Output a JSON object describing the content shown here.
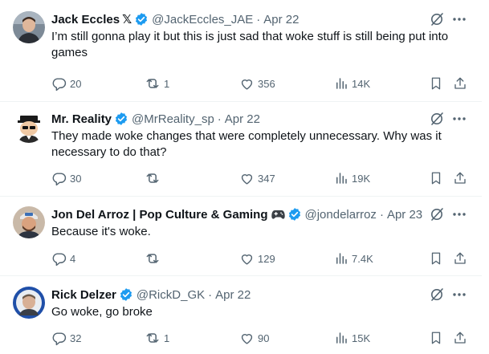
{
  "tweets": [
    {
      "name": "Jack Eccles",
      "name_suffix": "𝕏",
      "handle": "@JackEccles_JAE",
      "date": "Apr 22",
      "text": "I’m still gonna play it but this is just sad that woke stuff is still being put into games",
      "replies": "20",
      "reposts": "1",
      "likes": "356",
      "views": "14K"
    },
    {
      "name": "Mr. Reality",
      "name_suffix": "",
      "handle": "@MrReality_sp",
      "date": "Apr 22",
      "text": "They made woke changes that were completely unnecessary. Why was it necessary to do that?",
      "replies": "30",
      "reposts": "",
      "likes": "347",
      "views": "19K"
    },
    {
      "name": "Jon Del Arroz | Pop Culture & Gaming",
      "name_suffix": "",
      "handle": "@jondelarroz",
      "date": "Apr 23",
      "text": "Because it's woke.",
      "replies": "4",
      "reposts": "",
      "likes": "129",
      "views": "7.4K"
    },
    {
      "name": "Rick Delzer",
      "name_suffix": "",
      "handle": "@RickD_GK",
      "date": "Apr 22",
      "text": "Go woke, go broke",
      "replies": "32",
      "reposts": "1",
      "likes": "90",
      "views": "15K"
    }
  ],
  "separator": "·",
  "colors": {
    "text": "#0f1419",
    "secondary": "#536471",
    "verified_blue": "#1d9bf0",
    "divider": "#eff3f4"
  },
  "icons": [
    "verified-badge-icon",
    "grok-icon",
    "more-icon",
    "reply-icon",
    "repost-icon",
    "like-icon",
    "views-icon",
    "bookmark-icon",
    "share-icon",
    "game-controller-icon"
  ]
}
